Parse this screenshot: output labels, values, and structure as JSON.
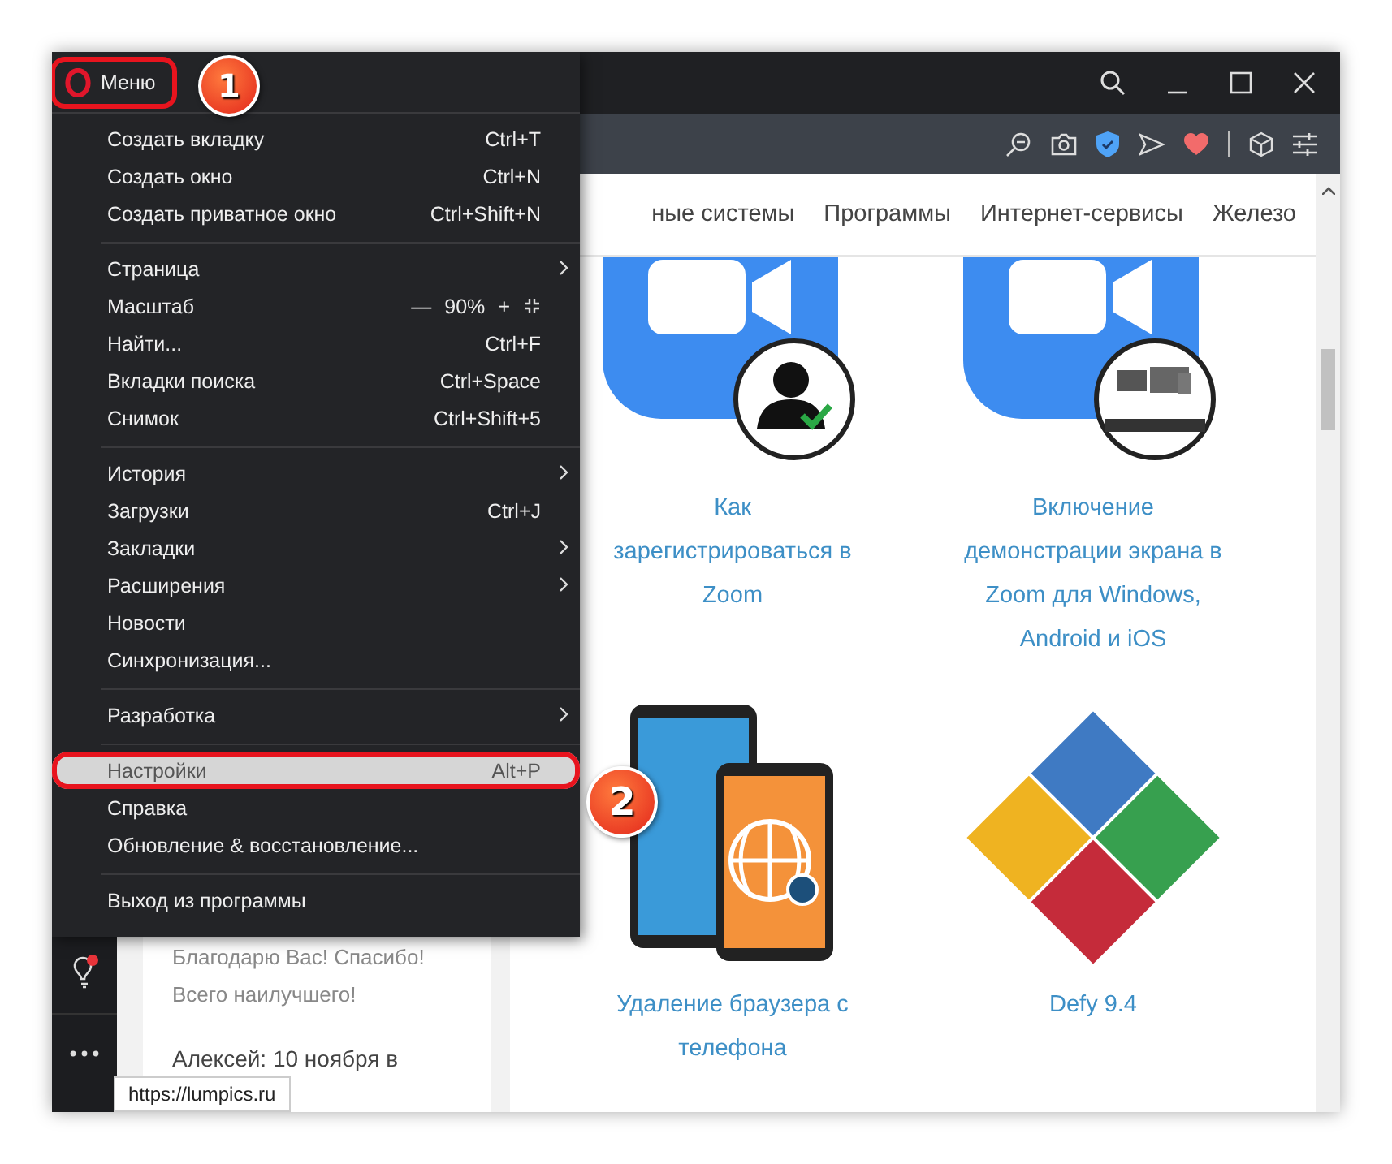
{
  "menu": {
    "title": "Меню",
    "sections": [
      {
        "items": [
          {
            "kind": "item",
            "label": "Создать вкладку",
            "shortcut": "Ctrl+T",
            "submenu": false,
            "selected": false
          },
          {
            "kind": "item",
            "label": "Создать окно",
            "shortcut": "Ctrl+N",
            "submenu": false,
            "selected": false
          },
          {
            "kind": "item",
            "label": "Создать приватное окно",
            "shortcut": "Ctrl+Shift+N",
            "submenu": false,
            "selected": false
          }
        ]
      },
      {
        "items": [
          {
            "kind": "item",
            "label": "Страница",
            "submenu": true,
            "selected": false
          },
          {
            "kind": "zoom",
            "label": "Масштаб",
            "minus": "—",
            "value": "90%",
            "plus": "+",
            "submenu": false,
            "selected": false
          },
          {
            "kind": "item",
            "label": "Найти...",
            "shortcut": "Ctrl+F",
            "submenu": false,
            "selected": false
          },
          {
            "kind": "item",
            "label": "Вкладки поиска",
            "shortcut": "Ctrl+Space",
            "submenu": false,
            "selected": false
          },
          {
            "kind": "item",
            "label": "Снимок",
            "shortcut": "Ctrl+Shift+5",
            "submenu": false,
            "selected": false
          }
        ]
      },
      {
        "items": [
          {
            "kind": "item",
            "label": "История",
            "submenu": true,
            "selected": false
          },
          {
            "kind": "item",
            "label": "Загрузки",
            "shortcut": "Ctrl+J",
            "submenu": false,
            "selected": false
          },
          {
            "kind": "item",
            "label": "Закладки",
            "submenu": true,
            "selected": false
          },
          {
            "kind": "item",
            "label": "Расширения",
            "submenu": true,
            "selected": false
          },
          {
            "kind": "item",
            "label": "Новости",
            "submenu": false,
            "selected": false
          },
          {
            "kind": "item",
            "label": "Синхронизация...",
            "submenu": false,
            "selected": false
          }
        ]
      },
      {
        "items": [
          {
            "kind": "item",
            "label": "Разработка",
            "submenu": true,
            "selected": false
          }
        ]
      },
      {
        "items": [
          {
            "kind": "item",
            "label": "Настройки",
            "shortcut": "Alt+P",
            "submenu": false,
            "selected": true
          },
          {
            "kind": "item",
            "label": "Справка",
            "submenu": false,
            "selected": false
          },
          {
            "kind": "item",
            "label": "Обновление & восстановление...",
            "submenu": false,
            "selected": false
          }
        ]
      },
      {
        "items": [
          {
            "kind": "item",
            "label": "Выход из программы",
            "submenu": false,
            "selected": false
          }
        ]
      }
    ]
  },
  "annotations": [
    {
      "number": "1"
    },
    {
      "number": "2"
    }
  ],
  "nav": [
    "ные системы",
    "Программы",
    "Интернет-сервисы",
    "Железо"
  ],
  "comments": [
    "Благодарю Вас! Спасибо!",
    "Всего наилучшего!",
    "Алексей: 10 ноября в"
  ],
  "articles": [
    {
      "kind": "video-user",
      "title": "Как зарегистрироваться в Zoom"
    },
    {
      "kind": "video-screen",
      "title": "Включение демонстрации экрана в Zoom для Windows, Android и iOS"
    },
    {
      "kind": "phones",
      "title": "Удаление браузера с телефона"
    },
    {
      "kind": "diamond",
      "title": "Defy 9.4"
    }
  ],
  "status_url": "https://lumpics.ru"
}
